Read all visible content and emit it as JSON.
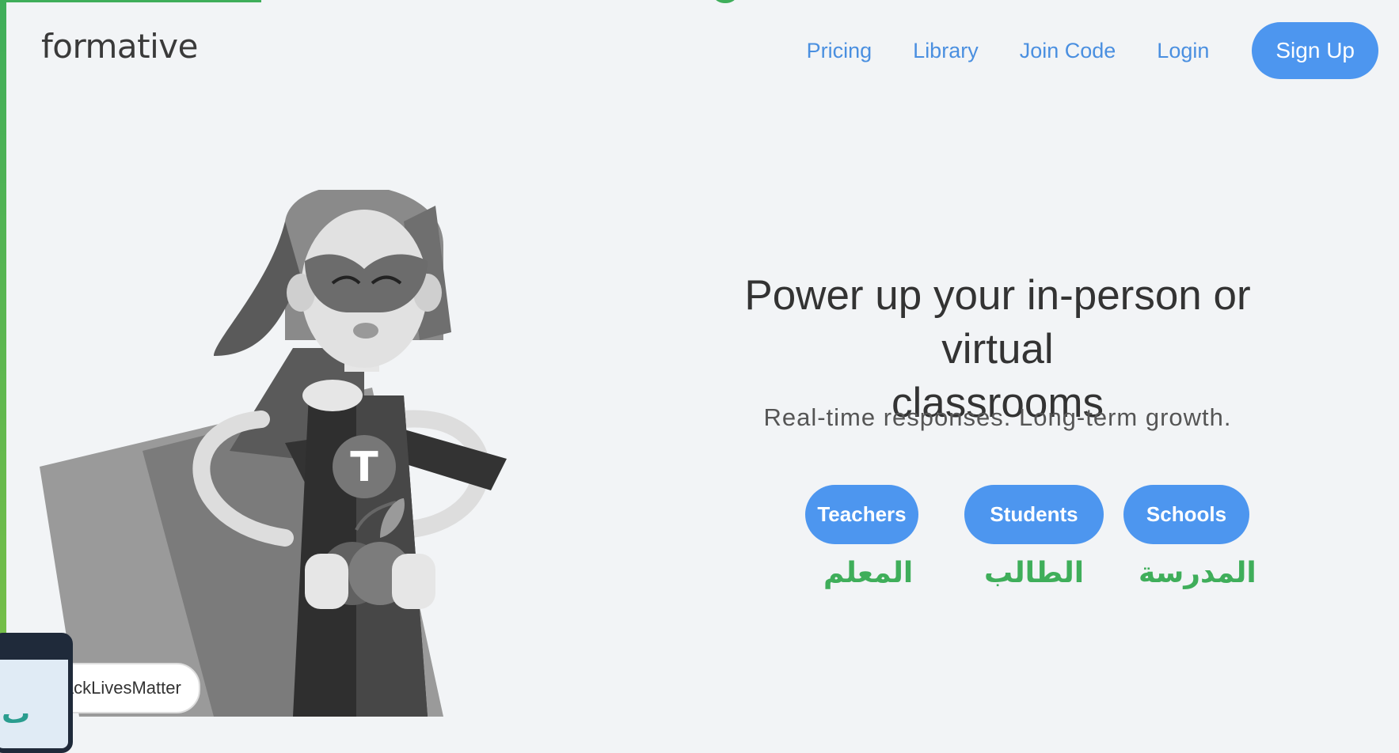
{
  "header": {
    "logo": "formative",
    "nav": {
      "pricing": "Pricing",
      "library": "Library",
      "join_code": "Join Code",
      "login": "Login",
      "sign_up": "Sign Up"
    }
  },
  "hero": {
    "title_line1": "Power up your in-person or virtual",
    "title_line2": "classrooms",
    "subtitle": "Real-time responses. Long-term growth.",
    "buttons": {
      "teachers": "Teachers",
      "students": "Students",
      "schools": "Schools"
    },
    "arabic": {
      "teacher": "المعلم",
      "student": "الطالب",
      "school": "المدرسة"
    },
    "illustration_badge": "T"
  },
  "footer": {
    "badge": "lackLivesMatter",
    "phone_glyph": "ٮ"
  },
  "colors": {
    "accent_blue": "#4d96ef",
    "accent_green": "#3fae5a"
  }
}
